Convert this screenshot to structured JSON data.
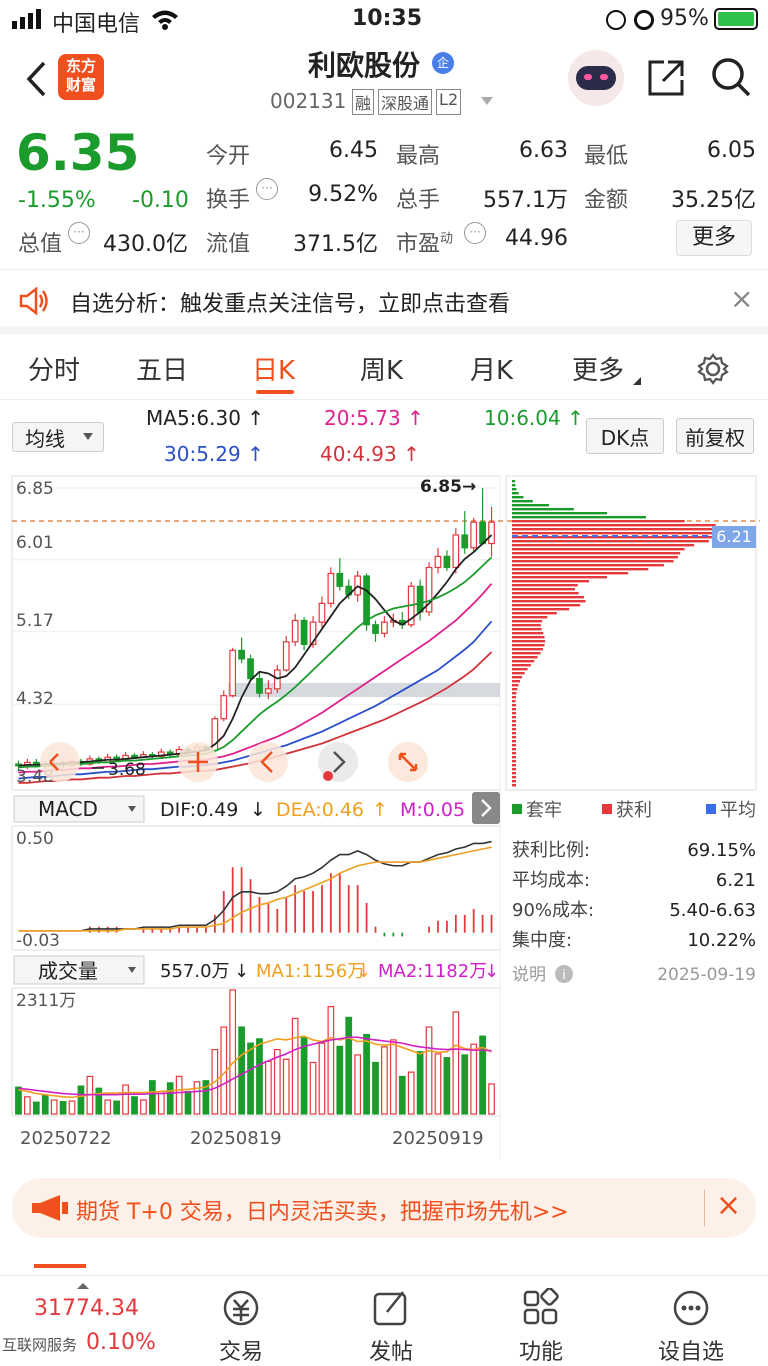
{
  "status_bar": {
    "carrier": "中国电信",
    "time": "10:35",
    "battery": "95%"
  },
  "header": {
    "back_icon": "chevron-left-icon",
    "logo_text_1": "东方",
    "logo_text_2": "财富",
    "title": "利欧股份",
    "title_badge": "企",
    "code": "002131",
    "badges": [
      "融",
      "深股通",
      "L2"
    ],
    "share_icon": "share-icon",
    "search_icon": "search-icon"
  },
  "quote": {
    "price": "6.35",
    "change_pct": "-1.55%",
    "change": "-0.10",
    "fields": [
      {
        "label": "今开",
        "value": "6.45"
      },
      {
        "label": "最高",
        "value": "6.63"
      },
      {
        "label": "最低",
        "value": "6.05"
      },
      {
        "label": "换手",
        "value": "9.52%"
      },
      {
        "label": "总手",
        "value": "557.1万"
      },
      {
        "label": "金额",
        "value": "35.25亿"
      },
      {
        "label": "总值",
        "value": "430.0亿"
      },
      {
        "label": "流值",
        "value": "371.5亿"
      },
      {
        "label": "市盈",
        "sup": "动",
        "value": "44.96"
      }
    ],
    "more_label": "更多"
  },
  "notice": {
    "text": "自选分析：触发重点关注信号，立即点击查看",
    "close": "×"
  },
  "tabs": [
    {
      "label": "分时",
      "active": false
    },
    {
      "label": "五日",
      "active": false
    },
    {
      "label": "日K",
      "active": true
    },
    {
      "label": "周K",
      "active": false
    },
    {
      "label": "月K",
      "active": false
    },
    {
      "label": "更多",
      "active": false
    }
  ],
  "ma_bar": {
    "selector": "均线",
    "ma5": "MA5:6.30",
    "ma20": "20:5.73",
    "ma10": "10:6.04",
    "ma30": "30:5.29",
    "ma40": "40:4.93",
    "dk_label": "DK点",
    "adjust_label": "前复权"
  },
  "price_chart": {
    "y_labels": [
      "6.85",
      "6.01",
      "5.17",
      "4.32",
      "3.48"
    ],
    "high_label": "6.85→",
    "low_label": "3.68",
    "cost_label": "6.21"
  },
  "macd": {
    "selector": "MACD",
    "dif": "DIF:0.49",
    "dea": "DEA:0.46",
    "m": "M:0.05",
    "y_top": "0.50",
    "y_bottom": "-0.03"
  },
  "volume": {
    "selector": "成交量",
    "vol": "557.0万",
    "ma1": "MA1:1156万",
    "ma2": "MA2:1182万",
    "y_top": "2311万",
    "dates": [
      "20250722",
      "20250819",
      "20250919"
    ]
  },
  "chip_panel": {
    "legend": [
      "套牢",
      "获利",
      "平均"
    ],
    "rows": [
      {
        "label": "获利比例:",
        "value": "69.15%"
      },
      {
        "label": "平均成本:",
        "value": "6.21"
      },
      {
        "label": "90%成本:",
        "value": "5.40-6.63"
      },
      {
        "label": "集中度:",
        "value": "10.22%"
      }
    ],
    "note_label": "说明",
    "date": "2025-09-19"
  },
  "ad": {
    "text": "期货 T+0 交易，日内灵活买卖，把握市场先机>>",
    "close": "×"
  },
  "bottom_nav": {
    "index_value": "31774.34",
    "index_name": "互联网服务",
    "index_pct": "0.10%",
    "items": [
      "交易",
      "发帖",
      "功能",
      "设自选"
    ]
  },
  "colors": {
    "up": "#e4393c",
    "down": "#1a9b2c",
    "accent": "#ff6a00",
    "ma5": "#222222",
    "ma10": "#1a9b2c",
    "ma20": "#e0208c",
    "ma30": "#2a4fc9",
    "ma40": "#d0333a",
    "dea": "#f0a020"
  },
  "chart_data": {
    "type": "candlestick",
    "y_range": [
      3.48,
      6.85
    ],
    "candles": [
      [
        3.62,
        3.6,
        3.66,
        3.55
      ],
      [
        3.6,
        3.64,
        3.68,
        3.56
      ],
      [
        3.64,
        3.62,
        3.68,
        3.58
      ],
      [
        3.62,
        3.6,
        3.66,
        3.56
      ],
      [
        3.6,
        3.63,
        3.67,
        3.58
      ],
      [
        3.63,
        3.61,
        3.66,
        3.57
      ],
      [
        3.61,
        3.65,
        3.69,
        3.59
      ],
      [
        3.65,
        3.62,
        3.68,
        3.6
      ],
      [
        3.62,
        3.68,
        3.72,
        3.6
      ],
      [
        3.68,
        3.64,
        3.71,
        3.62
      ],
      [
        3.64,
        3.7,
        3.74,
        3.63
      ],
      [
        3.7,
        3.67,
        3.73,
        3.65
      ],
      [
        3.67,
        3.72,
        3.76,
        3.66
      ],
      [
        3.72,
        3.7,
        3.75,
        3.68
      ],
      [
        3.7,
        3.73,
        3.77,
        3.69
      ],
      [
        3.73,
        3.71,
        3.76,
        3.69
      ],
      [
        3.71,
        3.76,
        3.8,
        3.7
      ],
      [
        3.76,
        3.73,
        3.79,
        3.71
      ],
      [
        3.73,
        3.79,
        3.83,
        3.72
      ],
      [
        3.79,
        3.76,
        3.82,
        3.74
      ],
      [
        3.76,
        3.82,
        3.86,
        3.75
      ],
      [
        3.82,
        3.78,
        3.85,
        3.77
      ],
      [
        3.78,
        4.15,
        4.18,
        3.77
      ],
      [
        4.15,
        4.42,
        4.48,
        4.12
      ],
      [
        4.42,
        4.95,
        4.98,
        4.4
      ],
      [
        4.95,
        4.85,
        5.1,
        4.8
      ],
      [
        4.85,
        4.62,
        4.9,
        4.58
      ],
      [
        4.62,
        4.45,
        4.7,
        4.4
      ],
      [
        4.45,
        4.5,
        4.6,
        4.38
      ],
      [
        4.5,
        4.72,
        4.78,
        4.45
      ],
      [
        4.72,
        5.05,
        5.12,
        4.7
      ],
      [
        5.05,
        5.3,
        5.38,
        5.0
      ],
      [
        5.3,
        5.02,
        5.34,
        4.95
      ],
      [
        5.02,
        5.28,
        5.35,
        4.98
      ],
      [
        5.28,
        5.5,
        5.58,
        5.22
      ],
      [
        5.5,
        5.85,
        5.92,
        5.45
      ],
      [
        5.85,
        5.7,
        6.03,
        5.65
      ],
      [
        5.7,
        5.6,
        5.78,
        5.55
      ],
      [
        5.6,
        5.82,
        5.88,
        5.52
      ],
      [
        5.82,
        5.25,
        5.85,
        5.18
      ],
      [
        5.25,
        5.15,
        5.3,
        5.05
      ],
      [
        5.15,
        5.28,
        5.35,
        5.1
      ],
      [
        5.28,
        5.3,
        5.38,
        5.22
      ],
      [
        5.3,
        5.25,
        5.4,
        5.2
      ],
      [
        5.25,
        5.7,
        5.75,
        5.22
      ],
      [
        5.7,
        5.4,
        5.78,
        5.3
      ],
      [
        5.4,
        5.92,
        5.98,
        5.35
      ],
      [
        5.92,
        6.05,
        6.15,
        5.85
      ],
      [
        6.05,
        5.92,
        6.12,
        5.88
      ],
      [
        5.92,
        6.3,
        6.38,
        5.85
      ],
      [
        6.3,
        6.15,
        6.58,
        6.08
      ],
      [
        6.15,
        6.45,
        6.5,
        6.1
      ],
      [
        6.45,
        6.2,
        6.85,
        6.18
      ],
      [
        6.2,
        6.45,
        6.63,
        6.05
      ]
    ],
    "series": [
      {
        "name": "MA5",
        "values": [
          3.6,
          3.61,
          3.61,
          3.62,
          3.62,
          3.63,
          3.63,
          3.64,
          3.65,
          3.66,
          3.67,
          3.67,
          3.68,
          3.69,
          3.7,
          3.71,
          3.72,
          3.73,
          3.74,
          3.75,
          3.77,
          3.78,
          3.85,
          3.95,
          4.15,
          4.4,
          4.6,
          4.7,
          4.68,
          4.62,
          4.65,
          4.75,
          4.9,
          5.05,
          5.2,
          5.35,
          5.5,
          5.6,
          5.7,
          5.65,
          5.55,
          5.42,
          5.3,
          5.25,
          5.32,
          5.4,
          5.5,
          5.62,
          5.75,
          5.9,
          6.02,
          6.1,
          6.2,
          6.3
        ]
      },
      {
        "name": "MA10",
        "values": [
          3.58,
          3.59,
          3.59,
          3.6,
          3.6,
          3.61,
          3.62,
          3.62,
          3.63,
          3.64,
          3.64,
          3.65,
          3.66,
          3.66,
          3.67,
          3.68,
          3.69,
          3.7,
          3.71,
          3.72,
          3.73,
          3.74,
          3.77,
          3.82,
          3.9,
          4.0,
          4.1,
          4.2,
          4.28,
          4.35,
          4.43,
          4.52,
          4.62,
          4.72,
          4.82,
          4.92,
          5.02,
          5.12,
          5.22,
          5.3,
          5.36,
          5.4,
          5.44,
          5.46,
          5.48,
          5.5,
          5.53,
          5.57,
          5.62,
          5.68,
          5.75,
          5.84,
          5.94,
          6.04
        ]
      },
      {
        "name": "MA20",
        "values": [
          3.52,
          3.53,
          3.53,
          3.54,
          3.55,
          3.55,
          3.56,
          3.57,
          3.57,
          3.58,
          3.59,
          3.59,
          3.6,
          3.61,
          3.62,
          3.62,
          3.63,
          3.64,
          3.65,
          3.66,
          3.66,
          3.67,
          3.69,
          3.71,
          3.74,
          3.78,
          3.82,
          3.86,
          3.9,
          3.94,
          3.99,
          4.04,
          4.1,
          4.16,
          4.22,
          4.29,
          4.36,
          4.43,
          4.5,
          4.57,
          4.64,
          4.71,
          4.78,
          4.85,
          4.92,
          4.99,
          5.06,
          5.14,
          5.22,
          5.3,
          5.4,
          5.5,
          5.61,
          5.73
        ]
      },
      {
        "name": "MA30",
        "values": [
          3.45,
          3.46,
          3.47,
          3.47,
          3.48,
          3.49,
          3.5,
          3.5,
          3.51,
          3.52,
          3.53,
          3.53,
          3.54,
          3.55,
          3.56,
          3.56,
          3.57,
          3.58,
          3.59,
          3.59,
          3.6,
          3.61,
          3.62,
          3.64,
          3.66,
          3.69,
          3.72,
          3.75,
          3.78,
          3.81,
          3.84,
          3.88,
          3.92,
          3.96,
          4.0,
          4.05,
          4.1,
          4.15,
          4.2,
          4.25,
          4.3,
          4.36,
          4.42,
          4.48,
          4.54,
          4.6,
          4.66,
          4.72,
          4.8,
          4.88,
          4.96,
          5.05,
          5.17,
          5.29
        ]
      },
      {
        "name": "MA40",
        "values": [
          3.4,
          3.4,
          3.41,
          3.42,
          3.42,
          3.43,
          3.44,
          3.44,
          3.45,
          3.46,
          3.46,
          3.47,
          3.48,
          3.48,
          3.49,
          3.5,
          3.51,
          3.51,
          3.52,
          3.53,
          3.54,
          3.54,
          3.55,
          3.57,
          3.59,
          3.61,
          3.63,
          3.66,
          3.68,
          3.71,
          3.74,
          3.77,
          3.8,
          3.83,
          3.86,
          3.9,
          3.94,
          3.98,
          4.02,
          4.06,
          4.1,
          4.14,
          4.19,
          4.24,
          4.29,
          4.34,
          4.39,
          4.45,
          4.51,
          4.58,
          4.65,
          4.73,
          4.83,
          4.93
        ]
      }
    ],
    "macd_dif": [
      0.01,
      0.01,
      0.01,
      0.01,
      0.01,
      0.01,
      0.01,
      0.01,
      0.02,
      0.02,
      0.02,
      0.02,
      0.02,
      0.02,
      0.03,
      0.03,
      0.03,
      0.03,
      0.04,
      0.04,
      0.04,
      0.04,
      0.07,
      0.12,
      0.19,
      0.22,
      0.22,
      0.21,
      0.21,
      0.22,
      0.25,
      0.29,
      0.3,
      0.32,
      0.35,
      0.39,
      0.42,
      0.42,
      0.44,
      0.42,
      0.39,
      0.37,
      0.36,
      0.36,
      0.38,
      0.38,
      0.4,
      0.42,
      0.43,
      0.45,
      0.46,
      0.48,
      0.48,
      0.49
    ],
    "macd_dea": [
      0.01,
      0.01,
      0.01,
      0.01,
      0.01,
      0.01,
      0.01,
      0.01,
      0.01,
      0.01,
      0.01,
      0.01,
      0.02,
      0.02,
      0.02,
      0.02,
      0.02,
      0.02,
      0.03,
      0.03,
      0.03,
      0.03,
      0.04,
      0.05,
      0.08,
      0.11,
      0.13,
      0.15,
      0.16,
      0.18,
      0.19,
      0.21,
      0.23,
      0.25,
      0.27,
      0.29,
      0.32,
      0.34,
      0.36,
      0.37,
      0.38,
      0.38,
      0.38,
      0.38,
      0.38,
      0.38,
      0.39,
      0.4,
      0.41,
      0.42,
      0.43,
      0.44,
      0.45,
      0.46
    ],
    "volume": [
      5.0,
      3.2,
      2.2,
      3.5,
      2.6,
      2.3,
      2.4,
      5.2,
      7.0,
      4.8,
      2.6,
      2.4,
      5.4,
      3.2,
      2.6,
      6.2,
      4.2,
      5.8,
      7.0,
      4.2,
      6.0,
      6.2,
      12.0,
      16.2,
      23.1,
      16.2,
      13.2,
      14.0,
      9.8,
      12.0,
      10.2,
      17.8,
      14.2,
      9.6,
      13.2,
      20.0,
      12.6,
      18.0,
      11.0,
      14.8,
      9.6,
      12.5,
      13.8,
      7.0,
      7.8,
      11.6,
      16.2,
      11.2,
      10.5,
      19.0,
      11.0,
      13.0,
      14.5,
      5.6
    ],
    "volume_ma1": [
      4.5,
      4.2,
      3.8,
      3.6,
      3.4,
      3.2,
      3.1,
      3.3,
      3.6,
      3.8,
      3.9,
      3.9,
      4.0,
      4.0,
      4.0,
      4.1,
      4.2,
      4.3,
      4.5,
      4.6,
      4.8,
      5.0,
      6.0,
      7.5,
      9.5,
      11.0,
      12.0,
      13.0,
      13.5,
      14.0,
      13.8,
      14.2,
      14.5,
      13.8,
      13.5,
      14.2,
      13.8,
      14.2,
      13.5,
      13.6,
      13.0,
      12.8,
      13.0,
      12.4,
      11.8,
      11.2,
      11.8,
      11.5,
      11.6,
      12.8,
      12.2,
      12.0,
      12.4,
      11.6
    ],
    "volume_ma2": [
      4.8,
      4.6,
      4.4,
      4.2,
      4.0,
      3.8,
      3.7,
      3.6,
      3.6,
      3.6,
      3.6,
      3.6,
      3.7,
      3.7,
      3.7,
      3.8,
      3.8,
      3.9,
      4.0,
      4.1,
      4.2,
      4.3,
      4.8,
      5.6,
      6.5,
      7.4,
      8.3,
      9.2,
      9.9,
      10.6,
      11.2,
      12.0,
      12.6,
      13.0,
      13.4,
      13.8,
      14.0,
      14.3,
      14.3,
      14.0,
      13.8,
      13.6,
      13.4,
      13.2,
      12.8,
      12.5,
      12.3,
      12.1,
      12.0,
      12.1,
      12.0,
      11.9,
      11.9,
      11.8
    ]
  }
}
